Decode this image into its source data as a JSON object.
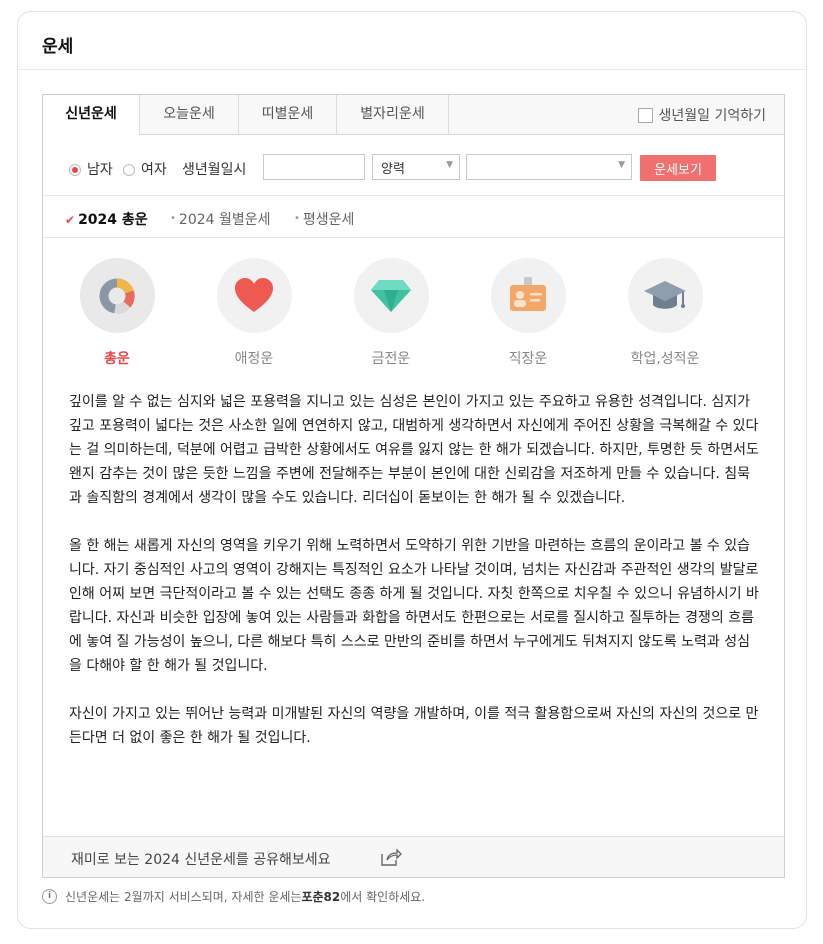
{
  "card": {
    "title": "운세"
  },
  "tabs": [
    {
      "label": "신년운세",
      "active": true
    },
    {
      "label": "오늘운세",
      "active": false
    },
    {
      "label": "띠별운세",
      "active": false
    },
    {
      "label": "별자리운세",
      "active": false
    }
  ],
  "remember_birth": {
    "label": "생년월일 기억하기",
    "checked": false
  },
  "form": {
    "gender_male": "남자",
    "gender_female": "여자",
    "selected_gender": "남자",
    "birth_label": "생년월일시",
    "birth_value": "",
    "calendar_select": "양력",
    "time_select": "",
    "submit_label": "운세보기"
  },
  "subtabs": [
    {
      "label": "2024 총운",
      "active": true
    },
    {
      "label": "2024 월별운세",
      "active": false
    },
    {
      "label": "평생운세",
      "active": false
    }
  ],
  "categories": [
    {
      "label": "총운",
      "icon": "pie-chart-icon",
      "active": true
    },
    {
      "label": "애정운",
      "icon": "heart-icon",
      "active": false
    },
    {
      "label": "금전운",
      "icon": "diamond-icon",
      "active": false
    },
    {
      "label": "직장운",
      "icon": "id-badge-icon",
      "active": false
    },
    {
      "label": "학업,성적운",
      "icon": "graduation-cap-icon",
      "active": false
    }
  ],
  "content": {
    "paragraph1": "깊이를 알 수 없는 심지와 넓은 포용력을 지니고 있는 심성은 본인이 가지고 있는 주요하고 유용한 성격입니다. 심지가 깊고 포용력이 넓다는 것은 사소한 일에 연연하지 않고, 대범하게 생각하면서 자신에게 주어진 상황을 극복해갈 수 있다는 걸 의미하는데, 덕분에 어렵고 급박한 상황에서도 여유를 잃지 않는 한 해가 되겠습니다. 하지만, 투명한 듯 하면서도 왠지 감추는 것이 많은 듯한 느낌을 주변에 전달해주는 부분이 본인에 대한 신뢰감을 저조하게 만들 수 있습니다. 침묵과 솔직함의 경계에서 생각이 많을 수도 있습니다. 리더십이 돋보이는 한 해가 될 수 있겠습니다.",
    "paragraph2": "올 한 해는 새롭게 자신의 영역을 키우기 위해 노력하면서 도약하기 위한 기반을 마련하는 흐름의 운이라고 볼 수 있습니다. 자기 중심적인 사고의 영역이 강해지는 특징적인 요소가 나타날 것이며, 넘치는 자신감과 주관적인 생각의 발달로 인해 어찌 보면 극단적이라고 볼 수 있는 선택도 종종 하게 될 것입니다. 자칫 한쪽으로 치우칠 수 있으니 유념하시기 바랍니다. 자신과 비슷한 입장에 놓여 있는 사람들과 화합을 하면서도 한편으로는 서로를 질시하고 질투하는 경쟁의 흐름에 놓여 질 가능성이 높으니, 다른 해보다 특히 스스로 만반의 준비를 하면서 누구에게도 뒤쳐지지 않도록 노력과 성심을 다해야 할 한 해가 될 것입니다.",
    "paragraph3": "자신이 가지고 있는 뛰어난 능력과 미개발된 자신의 역량을 개발하며, 이를 적극 활용함으로써 자신의 자신의 것으로 만든다면 더 없이 좋은 한 해가 될 것입니다."
  },
  "share": {
    "text": "재미로 보는 2024 신년운세를 공유해보세요",
    "icon": "share-icon"
  },
  "footnote": {
    "prefix": "신년운세는 2월까지 서비스되며, 자세한 운세는 ",
    "brand": "포춘82",
    "suffix": "에서 확인하세요.",
    "icon": "info-icon"
  },
  "colors": {
    "accent": "#e8474a",
    "button": "#f06f6f"
  }
}
